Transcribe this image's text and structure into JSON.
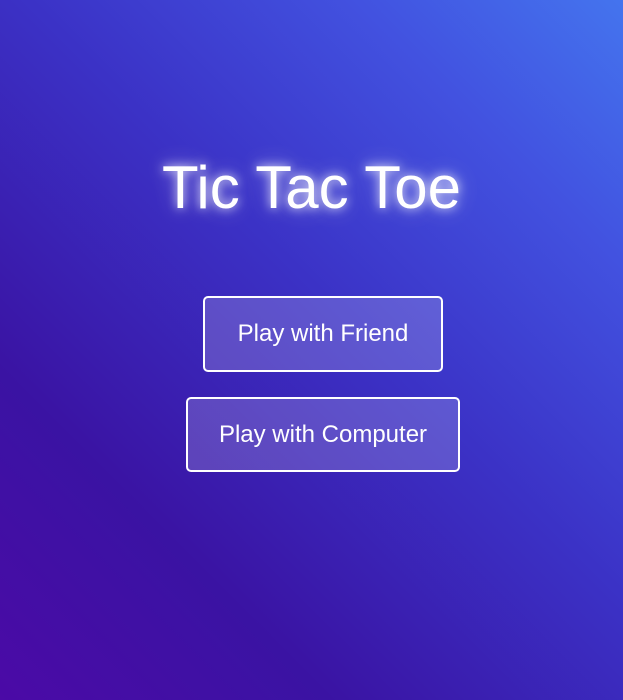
{
  "title": "Tic Tac Toe",
  "buttons": {
    "play_friend": "Play with Friend",
    "play_computer": "Play with Computer"
  },
  "colors": {
    "gradient_bottom_left": "#4b0aa6",
    "gradient_top_right": "#4474ee",
    "text": "#ffffff"
  }
}
